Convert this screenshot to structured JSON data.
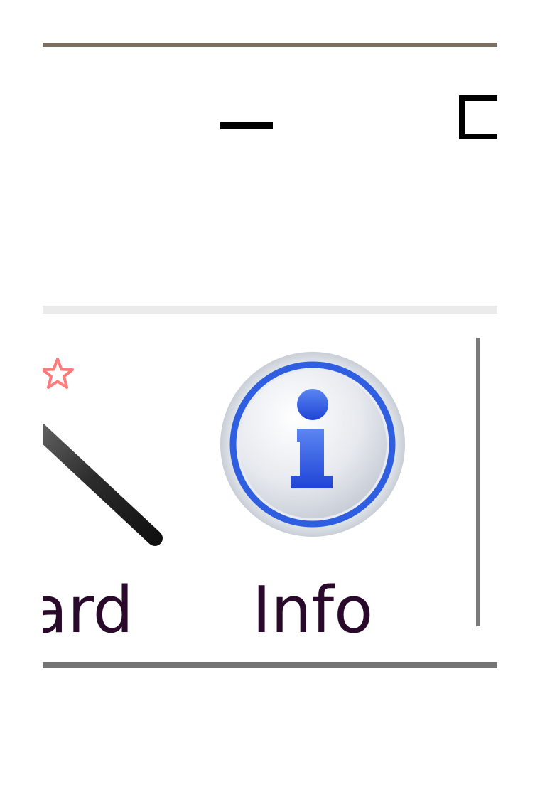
{
  "window": {
    "controls": {
      "minimize_icon": "minimize-icon",
      "maximize_icon": "maximize-icon"
    }
  },
  "toolbar": {
    "items": [
      {
        "label": "ard",
        "icon": "magic-wand-icon",
        "accent_icon": "star-icon",
        "partially_visible": true
      },
      {
        "label": "Info",
        "icon": "info-icon"
      }
    ]
  },
  "colors": {
    "border_top": "#7a6f62",
    "separator_light": "#ebebeb",
    "separator_dark": "#747474",
    "label_text": "#2a0a2a",
    "info_blue": "#2f5fe0",
    "star_red": "#ff7a7a"
  }
}
